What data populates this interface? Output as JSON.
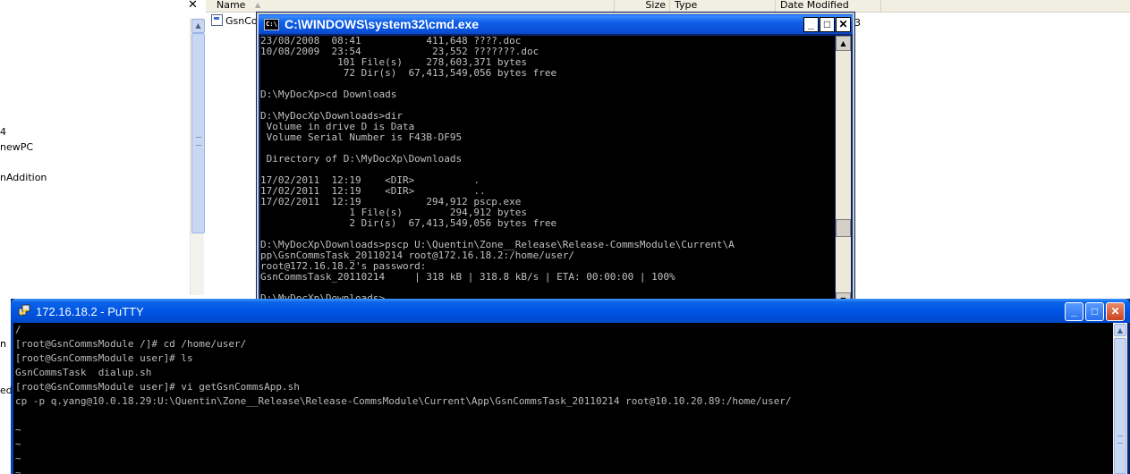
{
  "explorer": {
    "left_pane_items": [
      "4",
      "newPC",
      "nAddition",
      "n",
      "ed"
    ],
    "close_glyph": "✕",
    "columns": {
      "name": "Name",
      "size": "Size",
      "type": "Type",
      "date_modified": "Date Modified"
    },
    "file_name": "GsnCor",
    "stray_text": "3"
  },
  "cmd": {
    "title": "C:\\WINDOWS\\system32\\cmd.exe",
    "lines": [
      "23/08/2008  08:41           411,648 ????.doc",
      "10/08/2009  23:54            23,552 ???????.doc",
      "             101 File(s)    278,603,371 bytes",
      "              72 Dir(s)  67,413,549,056 bytes free",
      "",
      "D:\\MyDocXp>cd Downloads",
      "",
      "D:\\MyDocXp\\Downloads>dir",
      " Volume in drive D is Data",
      " Volume Serial Number is F43B-DF95",
      "",
      " Directory of D:\\MyDocXp\\Downloads",
      "",
      "17/02/2011  12:19    <DIR>          .",
      "17/02/2011  12:19    <DIR>          ..",
      "17/02/2011  12:19           294,912 pscp.exe",
      "               1 File(s)        294,912 bytes",
      "               2 Dir(s)  67,413,549,056 bytes free",
      "",
      "D:\\MyDocXp\\Downloads>pscp U:\\Quentin\\Zone__Release\\Release-CommsModule\\Current\\A",
      "pp\\GsnCommsTask_20110214 root@172.16.18.2:/home/user/",
      "root@172.16.18.2's password:",
      "GsnCommsTask_20110214     | 318 kB | 318.8 kB/s | ETA: 00:00:00 | 100%",
      "",
      "D:\\MyDocXp\\Downloads>"
    ]
  },
  "putty": {
    "title": "172.16.18.2 - PuTTY",
    "lines": [
      "/",
      "[root@GsnCommsModule /]# cd /home/user/",
      "[root@GsnCommsModule user]# ls",
      "GsnCommsTask  dialup.sh",
      "[root@GsnCommsModule user]# vi getGsnCommsApp.sh",
      "cp -p q.yang@10.0.18.29:U:\\Quentin\\Zone__Release\\Release-CommsModule\\Current\\App\\GsnCommsTask_20110214 root@10.10.20.89:/home/user/",
      "",
      "~",
      "~",
      "~",
      "~"
    ]
  },
  "colors": {
    "xp_title_blue": "#0054e3",
    "console_bg": "#000000",
    "console_fg": "#c0c0c0"
  }
}
